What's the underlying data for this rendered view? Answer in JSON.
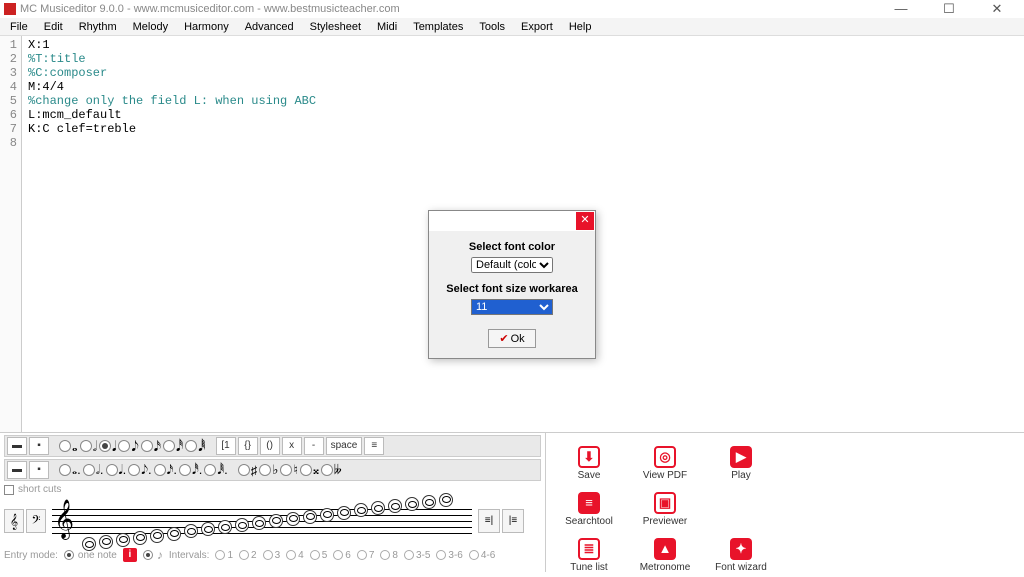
{
  "titlebar": {
    "text": "MC Musiceditor 9.0.0 - www.mcmusiceditor.com - www.bestmusicteacher.com"
  },
  "window_controls": {
    "minimize": "—",
    "maximize": "☐",
    "close": "✕"
  },
  "menubar": [
    "File",
    "Edit",
    "Rhythm",
    "Melody",
    "Harmony",
    "Advanced",
    "Stylesheet",
    "Midi",
    "Templates",
    "Tools",
    "Export",
    "Help"
  ],
  "editor": {
    "lines": [
      {
        "n": "1",
        "text": "X:1",
        "cls": "line-black"
      },
      {
        "n": "2",
        "text": "%T:title",
        "cls": "line-teal"
      },
      {
        "n": "3",
        "text": "%C:composer",
        "cls": "line-teal"
      },
      {
        "n": "4",
        "text": "M:4/4",
        "cls": "line-black"
      },
      {
        "n": "5",
        "text": "%change only the field L: when using ABC",
        "cls": "line-teal"
      },
      {
        "n": "6",
        "text": "L:mcm_default",
        "cls": "line-black"
      },
      {
        "n": "7",
        "text": "K:C clef=treble",
        "cls": "line-black"
      },
      {
        "n": "8",
        "text": "",
        "cls": "line-black"
      }
    ]
  },
  "dialog": {
    "label_color": "Select font color",
    "color_value": "Default (color)",
    "label_size": "Select font size workarea",
    "size_value": "11",
    "ok": "Ok",
    "close": "✕"
  },
  "bottom": {
    "shortcuts_label": "short cuts",
    "entry_label": "Entry mode:",
    "one_note": "one note",
    "intervals_label": "Intervals:",
    "interval_opts": [
      "1",
      "2",
      "3",
      "4",
      "5",
      "6",
      "7",
      "8",
      "3-5",
      "3-6",
      "4-6"
    ],
    "row1_extra": [
      "[1",
      "{}",
      "()",
      "x",
      "-",
      "space",
      "≡"
    ],
    "clef_treble": "𝄞",
    "clef_bass": "𝄢",
    "i": "i"
  },
  "actions": [
    {
      "label": "Save",
      "glyph": "⬇",
      "style": "outline"
    },
    {
      "label": "View PDF",
      "glyph": "◎",
      "style": "outline"
    },
    {
      "label": "Play",
      "glyph": "▶",
      "style": "solid"
    },
    {
      "label": "Searchtool",
      "glyph": "≡",
      "style": "solid"
    },
    {
      "label": "Previewer",
      "glyph": "▣",
      "style": "outline"
    },
    {
      "label": "",
      "glyph": "",
      "style": "blank"
    },
    {
      "label": "Tune list",
      "glyph": "≣",
      "style": "outline"
    },
    {
      "label": "Metronome",
      "glyph": "▲",
      "style": "solid"
    },
    {
      "label": "Font wizard",
      "glyph": "✦",
      "style": "solid"
    }
  ]
}
